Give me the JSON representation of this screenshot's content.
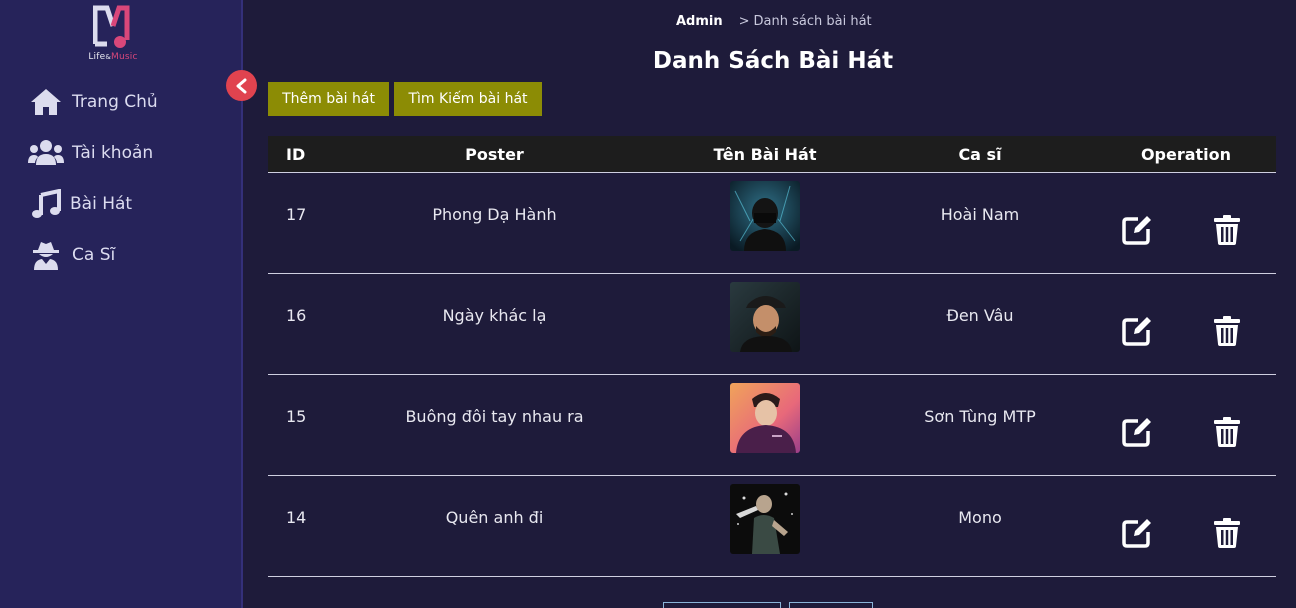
{
  "brand": {
    "line1": "Life",
    "amp": "&",
    "line2": "Music"
  },
  "sidebar": {
    "items": [
      {
        "label": "Trang Chủ",
        "icon": "home-icon"
      },
      {
        "label": "Tài khoản",
        "icon": "users-icon"
      },
      {
        "label": "Bài Hát",
        "icon": "music-icon"
      },
      {
        "label": "Ca Sĩ",
        "icon": "user-secret-icon"
      }
    ]
  },
  "breadcrumb": {
    "root": "Admin",
    "separator": ">",
    "current": "Danh sách bài hát"
  },
  "page": {
    "title": "Danh Sách Bài Hát",
    "add_button": "Thêm bài hát",
    "search_button": "Tìm Kiếm bài hát"
  },
  "table": {
    "headers": [
      "ID",
      "Poster",
      "Tên Bài Hát",
      "Ca sĩ",
      "Operation"
    ],
    "rows": [
      {
        "id": "17",
        "name": "Phong Dạ Hành",
        "singer": "Hoài Nam"
      },
      {
        "id": "16",
        "name": "Ngày khác lạ",
        "singer": "Đen Vâu"
      },
      {
        "id": "15",
        "name": "Buông đôi tay nhau ra",
        "singer": "Sơn Tùng MTP"
      },
      {
        "id": "14",
        "name": "Quên anh đi",
        "singer": "Mono"
      }
    ]
  },
  "colors": {
    "background": "#1e1b3a",
    "sidebar": "#26235a",
    "button": "#8c8c05",
    "collapse": "#e0434f",
    "logo_accent": "#d9477a"
  }
}
